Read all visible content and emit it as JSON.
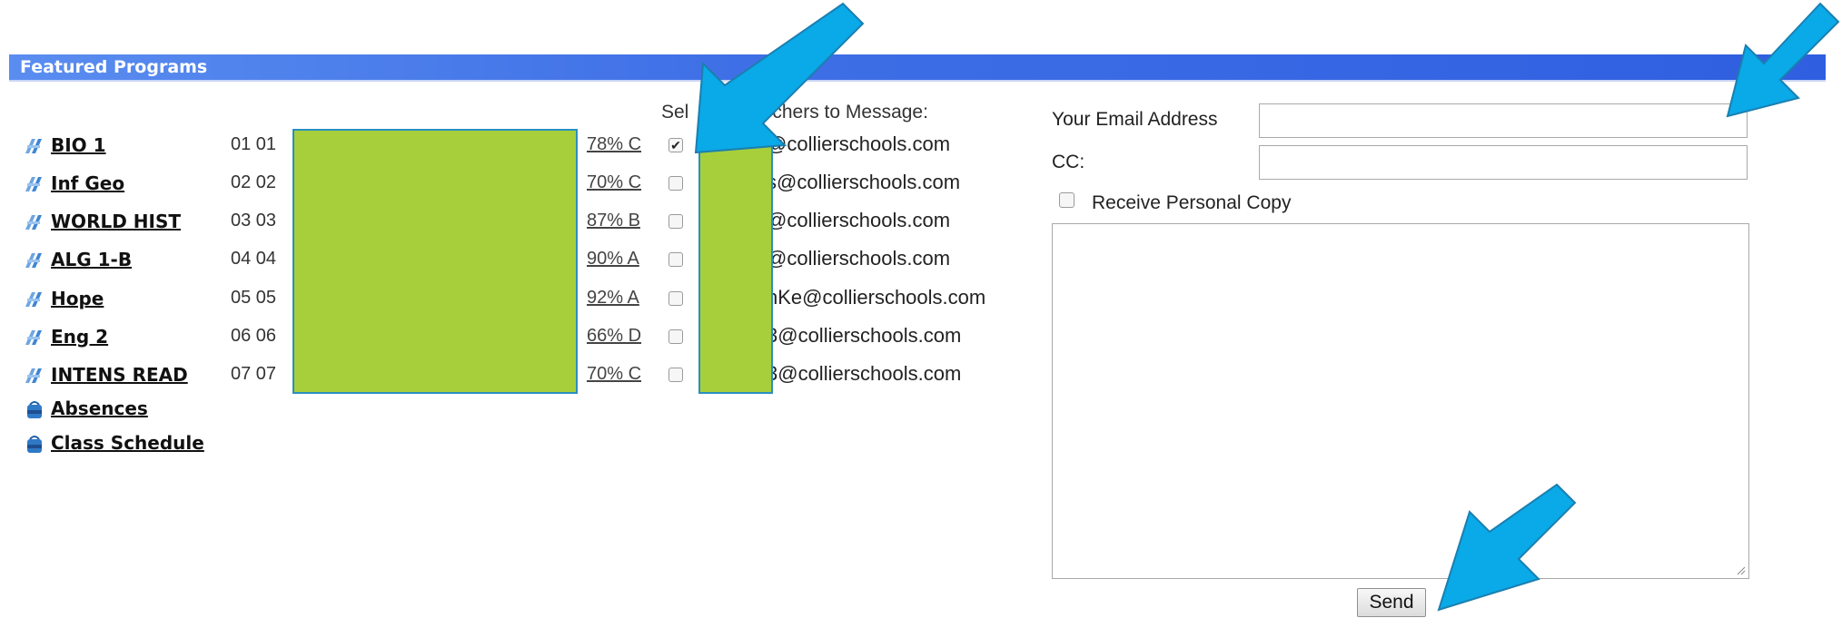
{
  "header": {
    "title": "Featured Programs"
  },
  "programs": [
    {
      "name": "BIO 1",
      "period": "01 01",
      "grade": "78% C",
      "checked": true,
      "email": "@collierschools.com"
    },
    {
      "name": "Inf Geo",
      "period": "02 02",
      "grade": "70% C",
      "checked": false,
      "email": "s@collierschools.com"
    },
    {
      "name": "WORLD HIST",
      "period": "03 03",
      "grade": "87% B",
      "checked": false,
      "email": "@collierschools.com"
    },
    {
      "name": "ALG 1-B",
      "period": "04 04",
      "grade": "90% A",
      "checked": false,
      "email": "@collierschools.com"
    },
    {
      "name": "Hope",
      "period": "05 05",
      "grade": "92% A",
      "checked": false,
      "email": "nKe@collierschools.com"
    },
    {
      "name": "Eng 2",
      "period": "06 06",
      "grade": "66% D",
      "checked": false,
      "email": "3@collierschools.com"
    },
    {
      "name": "INTENS READ",
      "period": "07 07",
      "grade": "70% C",
      "checked": false,
      "email": "3@collierschools.com"
    }
  ],
  "extra_links": [
    {
      "label": "Absences"
    },
    {
      "label": "Class Schedule"
    }
  ],
  "teachers_label": "Select Teachers to Message:",
  "teachers_label_visible": {
    "prefix": "Sel",
    "suffix": "chers to Message:"
  },
  "form": {
    "email_label": "Your Email Address",
    "email_value": "",
    "cc_label": "CC:",
    "cc_value": "",
    "personal_copy_label": "Receive Personal Copy",
    "personal_copy_checked": false,
    "message_value": "",
    "send_label": "Send"
  },
  "icons": {
    "program": "course-icon",
    "extra": "backpack-icon",
    "arrow": "callout-arrow"
  },
  "colors": {
    "header": "#3f6fe6",
    "redaction": "#a6cf3b",
    "arrow": "#0aa9e8"
  }
}
